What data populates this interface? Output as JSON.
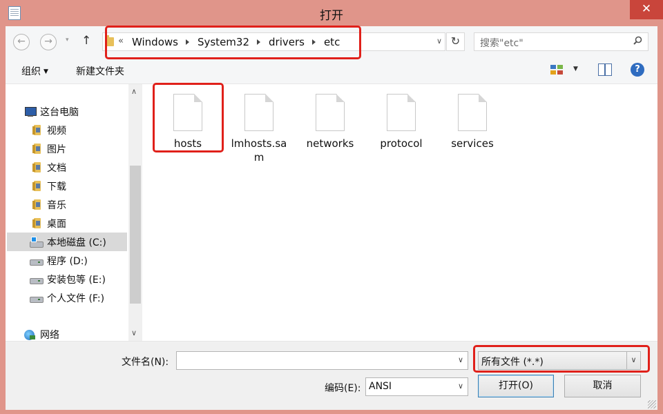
{
  "window": {
    "title": "打开",
    "close_glyph": "✕"
  },
  "nav": {
    "back_glyph": "←",
    "forward_glyph": "→",
    "recent_glyph": "▾",
    "up_glyph": "↑",
    "address_prefix": "«",
    "breadcrumbs": [
      "Windows",
      "System32",
      "drivers",
      "etc"
    ],
    "address_dropdown_glyph": "∨",
    "refresh_glyph": "↻",
    "search_placeholder": "搜索\"etc\""
  },
  "toolbar": {
    "organize_label": "组织",
    "organize_caret": "▼",
    "new_folder_label": "新建文件夹",
    "view_caret": "▼",
    "help_glyph": "?"
  },
  "sidebar": {
    "items": [
      {
        "label": "这台电脑",
        "icon": "computer-icon",
        "selected": false
      },
      {
        "label": "视频",
        "icon": "videos-folder-icon",
        "selected": false
      },
      {
        "label": "图片",
        "icon": "pictures-folder-icon",
        "selected": false
      },
      {
        "label": "文档",
        "icon": "documents-folder-icon",
        "selected": false
      },
      {
        "label": "下载",
        "icon": "downloads-folder-icon",
        "selected": false
      },
      {
        "label": "音乐",
        "icon": "music-folder-icon",
        "selected": false
      },
      {
        "label": "桌面",
        "icon": "desktop-folder-icon",
        "selected": false
      },
      {
        "label": "本地磁盘 (C:)",
        "icon": "system-drive-icon",
        "selected": true
      },
      {
        "label": "程序 (D:)",
        "icon": "drive-icon",
        "selected": false
      },
      {
        "label": "安装包等 (E:)",
        "icon": "drive-icon",
        "selected": false
      },
      {
        "label": "个人文件 (F:)",
        "icon": "drive-icon",
        "selected": false
      },
      {
        "label": "网络",
        "icon": "network-icon",
        "selected": false
      }
    ],
    "scroll_up_glyph": "∧",
    "scroll_down_glyph": "∨"
  },
  "files": [
    {
      "name": "hosts",
      "highlighted": true
    },
    {
      "name": "lmhosts.sam",
      "highlighted": false
    },
    {
      "name": "networks",
      "highlighted": false
    },
    {
      "name": "protocol",
      "highlighted": false
    },
    {
      "name": "services",
      "highlighted": false
    }
  ],
  "bottom": {
    "filename_label": "文件名(N):",
    "filename_value": "",
    "filename_dd_glyph": "∨",
    "filter_value": "所有文件  (*.*)",
    "filter_dd_glyph": "∨",
    "encoding_label": "编码(E):",
    "encoding_value": "ANSI",
    "encoding_dd_glyph": "∨",
    "open_label": "打开(O)",
    "cancel_label": "取消"
  },
  "colors": {
    "title_bar": "#e0958a",
    "close_button": "#c9453b",
    "annotation_red": "#e0201a",
    "selection": "#d9d9d9"
  }
}
